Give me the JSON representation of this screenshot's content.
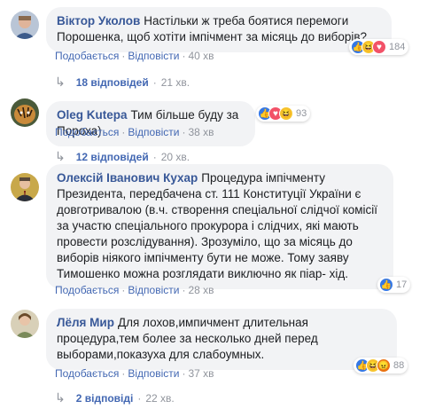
{
  "comments": [
    {
      "author": "Віктор Уколов",
      "text": "Настільки ж треба боятися перемоги Порошенка, щоб хотіти імпічмент за місяць до виборів?",
      "like_label": "Подобається",
      "reply_label": "Відповісти",
      "time": "40 хв",
      "reaction_count": "184",
      "replies_label": "18 відповідей",
      "replies_time": "21 хв."
    },
    {
      "author": "Oleg Kutepa",
      "text": "Тим більше буду за Пороха)",
      "like_label": "Подобається",
      "reply_label": "Відповісти",
      "time": "38 хв",
      "reaction_count": "93",
      "replies_label": "12 відповідей",
      "replies_time": "20 хв."
    },
    {
      "author": "Олексій Іванович Кухар",
      "text": "Процедура імпічменту Президента, передбачена ст. 111 Конституції України є довготривалою (в.ч. створення спеціальної слідчої комісії за участю спеціального прокурора і слідчих, які мають провести розслідування). Зрозуміло, що за місяць до виборів ніякого імпічменту бути не може. Тому заяву Тимошенко можна розглядати виключно як піар- хід.",
      "like_label": "Подобається",
      "reply_label": "Відповісти",
      "time": "28 хв",
      "reaction_count": "17"
    },
    {
      "author": "Лёля Мир",
      "text": "Для лохов,импичмент длительная процедура,тем более за несколько дней перед выборами,показуха для слабоумных.",
      "like_label": "Подобається",
      "reply_label": "Відповісти",
      "time": "37 хв",
      "reaction_count": "88",
      "replies_label": "2 відповіді",
      "replies_time": "22 хв."
    }
  ],
  "icons": {
    "like": "like-icon",
    "haha": "haha-icon",
    "love": "love-icon",
    "angry": "angry-icon",
    "reply_arrow": "reply-arrow-icon"
  },
  "colors": {
    "link": "#4267b2",
    "author": "#385898",
    "bubble": "#f2f3f5",
    "like": "#3578e5",
    "haha": "#f7c52e",
    "love": "#f25268",
    "angry": "#e9710f"
  }
}
